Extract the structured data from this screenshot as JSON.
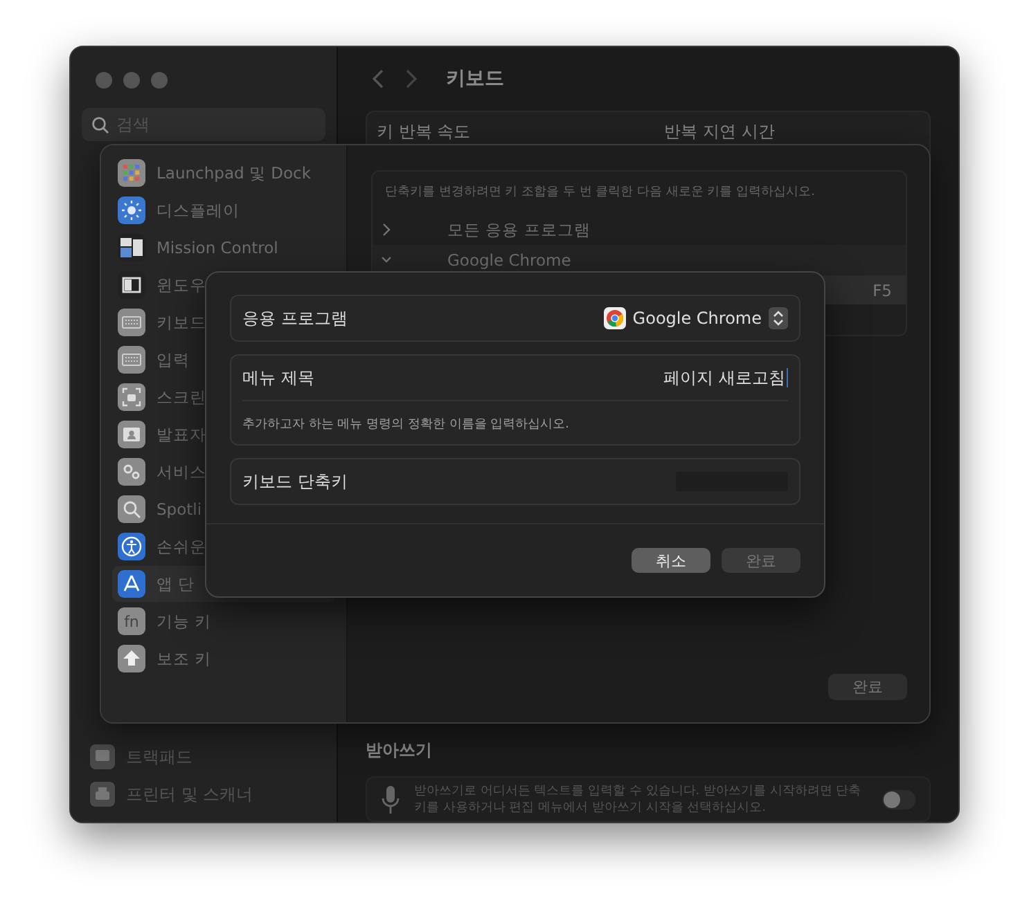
{
  "window": {
    "title": "키보드",
    "search": {
      "placeholder": "검색"
    },
    "keyboard_card": {
      "labels": [
        "키 반복 속도",
        "반복 지연 시간"
      ]
    },
    "sidebar_items": [
      {
        "label": "트랙패드",
        "selected": false
      },
      {
        "label": "프린터 및 스캐너",
        "selected": false
      }
    ],
    "dictation": {
      "heading": "받아쓰기",
      "description": "받아쓰기로 어디서든 텍스트를 입력할 수 있습니다. 받아쓰기를 시작하려면 단축키를 사용하거나 편집 메뉴에서 받아쓰기 시작을 선택하십시오.",
      "on": false
    }
  },
  "shortcuts_sheet": {
    "sidebar_items": [
      {
        "label": "Launchpad 및 Dock",
        "selected": false
      },
      {
        "label": "디스플레이",
        "selected": false
      },
      {
        "label": "Mission Control",
        "selected": false
      },
      {
        "label": "윈도우",
        "selected": false
      },
      {
        "label": "키보드",
        "selected": false
      },
      {
        "label": "입력",
        "selected": false
      },
      {
        "label": "스크린",
        "selected": false
      },
      {
        "label": "발표자",
        "selected": false
      },
      {
        "label": "서비스",
        "selected": false
      },
      {
        "label": "Spotli",
        "selected": false
      },
      {
        "label": "손쉬운",
        "selected": false
      },
      {
        "label": "앱 단",
        "selected": true
      },
      {
        "label": "기능 키",
        "selected": false,
        "icon_text": "fn"
      },
      {
        "label": "보조 키",
        "selected": false
      }
    ],
    "hint": "단축키를 변경하려면 키 조합을 두 번 클릭한 다음 새로운 키를 입력하십시오.",
    "groups": [
      {
        "label": "모든 응용 프로그램",
        "expanded": false
      },
      {
        "label": "Google Chrome",
        "expanded": true
      }
    ],
    "shortcut": {
      "key": "F5",
      "selected": true
    },
    "done_button": "완료"
  },
  "add_dialog": {
    "app": {
      "label": "응용 프로그램",
      "value": "Google Chrome"
    },
    "menu_title": {
      "label": "메뉴 제목",
      "value": "페이지 새로고침",
      "hint": "추가하고자 하는 메뉴 명령의 정확한 이름을 입력하십시오."
    },
    "shortcut": {
      "label": "키보드 단축키"
    },
    "buttons": [
      {
        "label": "취소",
        "disabled": false
      },
      {
        "label": "완료",
        "disabled": true
      }
    ]
  }
}
